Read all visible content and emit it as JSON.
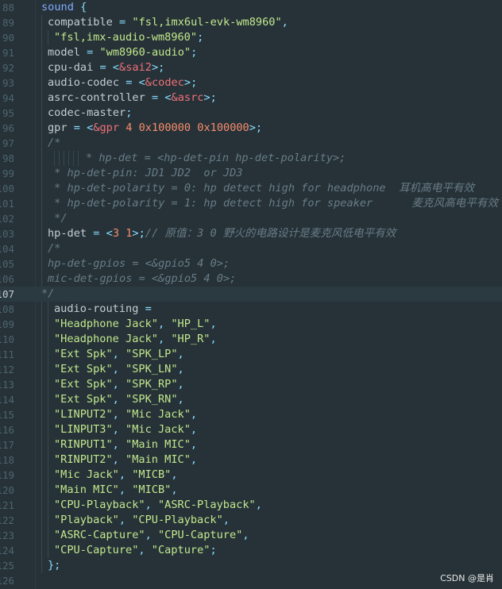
{
  "editor": {
    "lines": [
      {
        "n": "88",
        "indent": 0,
        "tokens": [
          [
            "node",
            "sound"
          ],
          [
            "op",
            " {"
          ]
        ]
      },
      {
        "n": "89",
        "indent": 1,
        "tokens": [
          [
            "prop",
            "compatible"
          ],
          [
            "op",
            " = "
          ],
          [
            "str",
            "\"fsl,imx6ul-evk-wm8960\""
          ],
          [
            "op",
            ","
          ]
        ]
      },
      {
        "n": "90",
        "indent": 2,
        "tokens": [
          [
            "str",
            "\"fsl,imx-audio-wm8960\""
          ],
          [
            "op",
            ";"
          ]
        ]
      },
      {
        "n": "91",
        "indent": 1,
        "tokens": [
          [
            "prop",
            "model"
          ],
          [
            "op",
            " = "
          ],
          [
            "str",
            "\"wm8960-audio\""
          ],
          [
            "op",
            ";"
          ]
        ]
      },
      {
        "n": "92",
        "indent": 1,
        "tokens": [
          [
            "prop",
            "cpu-dai"
          ],
          [
            "op",
            " = <"
          ],
          [
            "ref",
            "&sai2"
          ],
          [
            "op",
            ">;"
          ]
        ]
      },
      {
        "n": "93",
        "indent": 1,
        "tokens": [
          [
            "prop",
            "audio-codec"
          ],
          [
            "op",
            " = <"
          ],
          [
            "ref",
            "&codec"
          ],
          [
            "op",
            ">;"
          ]
        ]
      },
      {
        "n": "94",
        "indent": 1,
        "tokens": [
          [
            "prop",
            "asrc-controller"
          ],
          [
            "op",
            " = <"
          ],
          [
            "ref",
            "&asrc"
          ],
          [
            "op",
            ">;"
          ]
        ]
      },
      {
        "n": "95",
        "indent": 1,
        "tokens": [
          [
            "prop",
            "codec-master"
          ],
          [
            "op",
            ";"
          ]
        ]
      },
      {
        "n": "96",
        "indent": 1,
        "tokens": [
          [
            "prop",
            "gpr"
          ],
          [
            "op",
            " = <"
          ],
          [
            "ref",
            "&gpr"
          ],
          [
            "num",
            " 4 0x100000 0x100000"
          ],
          [
            "op",
            ">;"
          ]
        ]
      },
      {
        "n": "97",
        "indent": 1,
        "tokens": [
          [
            "cmt",
            "/*"
          ]
        ]
      },
      {
        "n": "98",
        "indent": 5,
        "tokens": [
          [
            "cmt",
            "* hp-det = <hp-det-pin hp-det-polarity>;"
          ]
        ]
      },
      {
        "n": "99",
        "indent": 1,
        "tokens": [
          [
            "cmt",
            " * hp-det-pin: JD1 JD2  or JD3"
          ]
        ]
      },
      {
        "n": "100",
        "indent": 1,
        "tokens": [
          [
            "cmt",
            " * hp-det-polarity = 0: hp detect high for headphone  耳机高电平有效"
          ]
        ]
      },
      {
        "n": "101",
        "indent": 1,
        "tokens": [
          [
            "cmt",
            " * hp-det-polarity = 1: hp detect high for speaker      麦克风高电平有效"
          ]
        ]
      },
      {
        "n": "102",
        "indent": 1,
        "tokens": [
          [
            "cmt",
            " */"
          ]
        ]
      },
      {
        "n": "103",
        "indent": 1,
        "tokens": [
          [
            "prop",
            "hp-det"
          ],
          [
            "op",
            " = <"
          ],
          [
            "num",
            "3 1"
          ],
          [
            "op",
            ">;"
          ],
          [
            "cmt",
            "// 原值：3 0 野火的电路设计是麦克风低电平有效"
          ]
        ]
      },
      {
        "n": "104",
        "indent": 1,
        "tokens": [
          [
            "cmt",
            "/*"
          ]
        ]
      },
      {
        "n": "105",
        "indent": 1,
        "tokens": [
          [
            "cmt",
            "hp-det-gpios = <&gpio5 4 0>;"
          ]
        ]
      },
      {
        "n": "106",
        "indent": 1,
        "tokens": [
          [
            "cmt",
            "mic-det-gpios = <&gpio5 4 0>;"
          ]
        ]
      },
      {
        "n": "107",
        "indent": 0,
        "current": true,
        "tokens": [
          [
            "cmt",
            "*/"
          ]
        ]
      },
      {
        "n": "108",
        "indent": 2,
        "tokens": [
          [
            "prop",
            "audio-routing"
          ],
          [
            "op",
            " ="
          ]
        ]
      },
      {
        "n": "109",
        "indent": 2,
        "tokens": [
          [
            "str",
            "\"Headphone Jack\""
          ],
          [
            "op",
            ", "
          ],
          [
            "str",
            "\"HP_L\""
          ],
          [
            "op",
            ","
          ]
        ]
      },
      {
        "n": "110",
        "indent": 2,
        "tokens": [
          [
            "str",
            "\"Headphone Jack\""
          ],
          [
            "op",
            ", "
          ],
          [
            "str",
            "\"HP_R\""
          ],
          [
            "op",
            ","
          ]
        ]
      },
      {
        "n": "111",
        "indent": 2,
        "tokens": [
          [
            "str",
            "\"Ext Spk\""
          ],
          [
            "op",
            ", "
          ],
          [
            "str",
            "\"SPK_LP\""
          ],
          [
            "op",
            ","
          ]
        ]
      },
      {
        "n": "112",
        "indent": 2,
        "tokens": [
          [
            "str",
            "\"Ext Spk\""
          ],
          [
            "op",
            ", "
          ],
          [
            "str",
            "\"SPK_LN\""
          ],
          [
            "op",
            ","
          ]
        ]
      },
      {
        "n": "113",
        "indent": 2,
        "tokens": [
          [
            "str",
            "\"Ext Spk\""
          ],
          [
            "op",
            ", "
          ],
          [
            "str",
            "\"SPK_RP\""
          ],
          [
            "op",
            ","
          ]
        ]
      },
      {
        "n": "114",
        "indent": 2,
        "tokens": [
          [
            "str",
            "\"Ext Spk\""
          ],
          [
            "op",
            ", "
          ],
          [
            "str",
            "\"SPK_RN\""
          ],
          [
            "op",
            ","
          ]
        ]
      },
      {
        "n": "115",
        "indent": 2,
        "tokens": [
          [
            "str",
            "\"LINPUT2\""
          ],
          [
            "op",
            ", "
          ],
          [
            "str",
            "\"Mic Jack\""
          ],
          [
            "op",
            ","
          ]
        ]
      },
      {
        "n": "116",
        "indent": 2,
        "tokens": [
          [
            "str",
            "\"LINPUT3\""
          ],
          [
            "op",
            ", "
          ],
          [
            "str",
            "\"Mic Jack\""
          ],
          [
            "op",
            ","
          ]
        ]
      },
      {
        "n": "117",
        "indent": 2,
        "tokens": [
          [
            "str",
            "\"RINPUT1\""
          ],
          [
            "op",
            ", "
          ],
          [
            "str",
            "\"Main MIC\""
          ],
          [
            "op",
            ","
          ]
        ]
      },
      {
        "n": "118",
        "indent": 2,
        "tokens": [
          [
            "str",
            "\"RINPUT2\""
          ],
          [
            "op",
            ", "
          ],
          [
            "str",
            "\"Main MIC\""
          ],
          [
            "op",
            ","
          ]
        ]
      },
      {
        "n": "119",
        "indent": 2,
        "tokens": [
          [
            "str",
            "\"Mic Jack\""
          ],
          [
            "op",
            ", "
          ],
          [
            "str",
            "\"MICB\""
          ],
          [
            "op",
            ","
          ]
        ]
      },
      {
        "n": "120",
        "indent": 2,
        "tokens": [
          [
            "str",
            "\"Main MIC\""
          ],
          [
            "op",
            ", "
          ],
          [
            "str",
            "\"MICB\""
          ],
          [
            "op",
            ","
          ]
        ]
      },
      {
        "n": "121",
        "indent": 2,
        "tokens": [
          [
            "str",
            "\"CPU-Playback\""
          ],
          [
            "op",
            ", "
          ],
          [
            "str",
            "\"ASRC-Playback\""
          ],
          [
            "op",
            ","
          ]
        ]
      },
      {
        "n": "122",
        "indent": 2,
        "tokens": [
          [
            "str",
            "\"Playback\""
          ],
          [
            "op",
            ", "
          ],
          [
            "str",
            "\"CPU-Playback\""
          ],
          [
            "op",
            ","
          ]
        ]
      },
      {
        "n": "123",
        "indent": 2,
        "tokens": [
          [
            "str",
            "\"ASRC-Capture\""
          ],
          [
            "op",
            ", "
          ],
          [
            "str",
            "\"CPU-Capture\""
          ],
          [
            "op",
            ","
          ]
        ]
      },
      {
        "n": "124",
        "indent": 2,
        "tokens": [
          [
            "str",
            "\"CPU-Capture\""
          ],
          [
            "op",
            ", "
          ],
          [
            "str",
            "\"Capture\""
          ],
          [
            "op",
            ";"
          ]
        ]
      },
      {
        "n": "125",
        "indent": 1,
        "tokens": [
          [
            "op",
            "};"
          ]
        ]
      },
      {
        "n": "126",
        "indent": 0,
        "tokens": []
      }
    ]
  },
  "watermark": "CSDN @是肖",
  "colors": {
    "background": "#263238",
    "string": "#c3e88d",
    "reference": "#f07178",
    "number": "#f78c6c",
    "node": "#82aaff",
    "comment": "#697c86"
  }
}
